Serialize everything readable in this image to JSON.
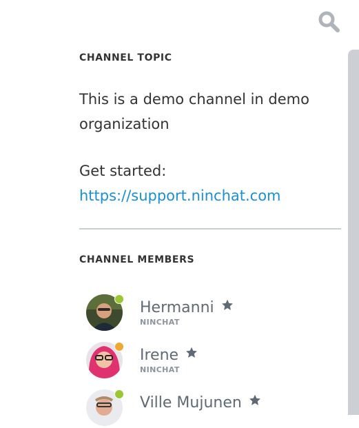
{
  "header": {
    "search_icon": "search-icon"
  },
  "topic": {
    "title": "CHANNEL TOPIC",
    "text": "This is a demo channel in demo organization",
    "intro": "Get started:",
    "link": "https://support.ninchat.com"
  },
  "members": {
    "title": "CHANNEL MEMBERS",
    "list": [
      {
        "name": "Hermanni",
        "org": "NINCHAT",
        "status_color": "#9bc733",
        "starred": true
      },
      {
        "name": "Irene",
        "org": "NINCHAT",
        "status_color": "#f0a830",
        "starred": true
      },
      {
        "name": "Ville Mujunen",
        "org": "",
        "status_color": "#9bc733",
        "starred": true
      }
    ]
  },
  "colors": {
    "link": "#1b8fd6",
    "name": "#5f6a75",
    "divider": "#c6cfd7",
    "scrollbar": "#ccd0d5"
  }
}
